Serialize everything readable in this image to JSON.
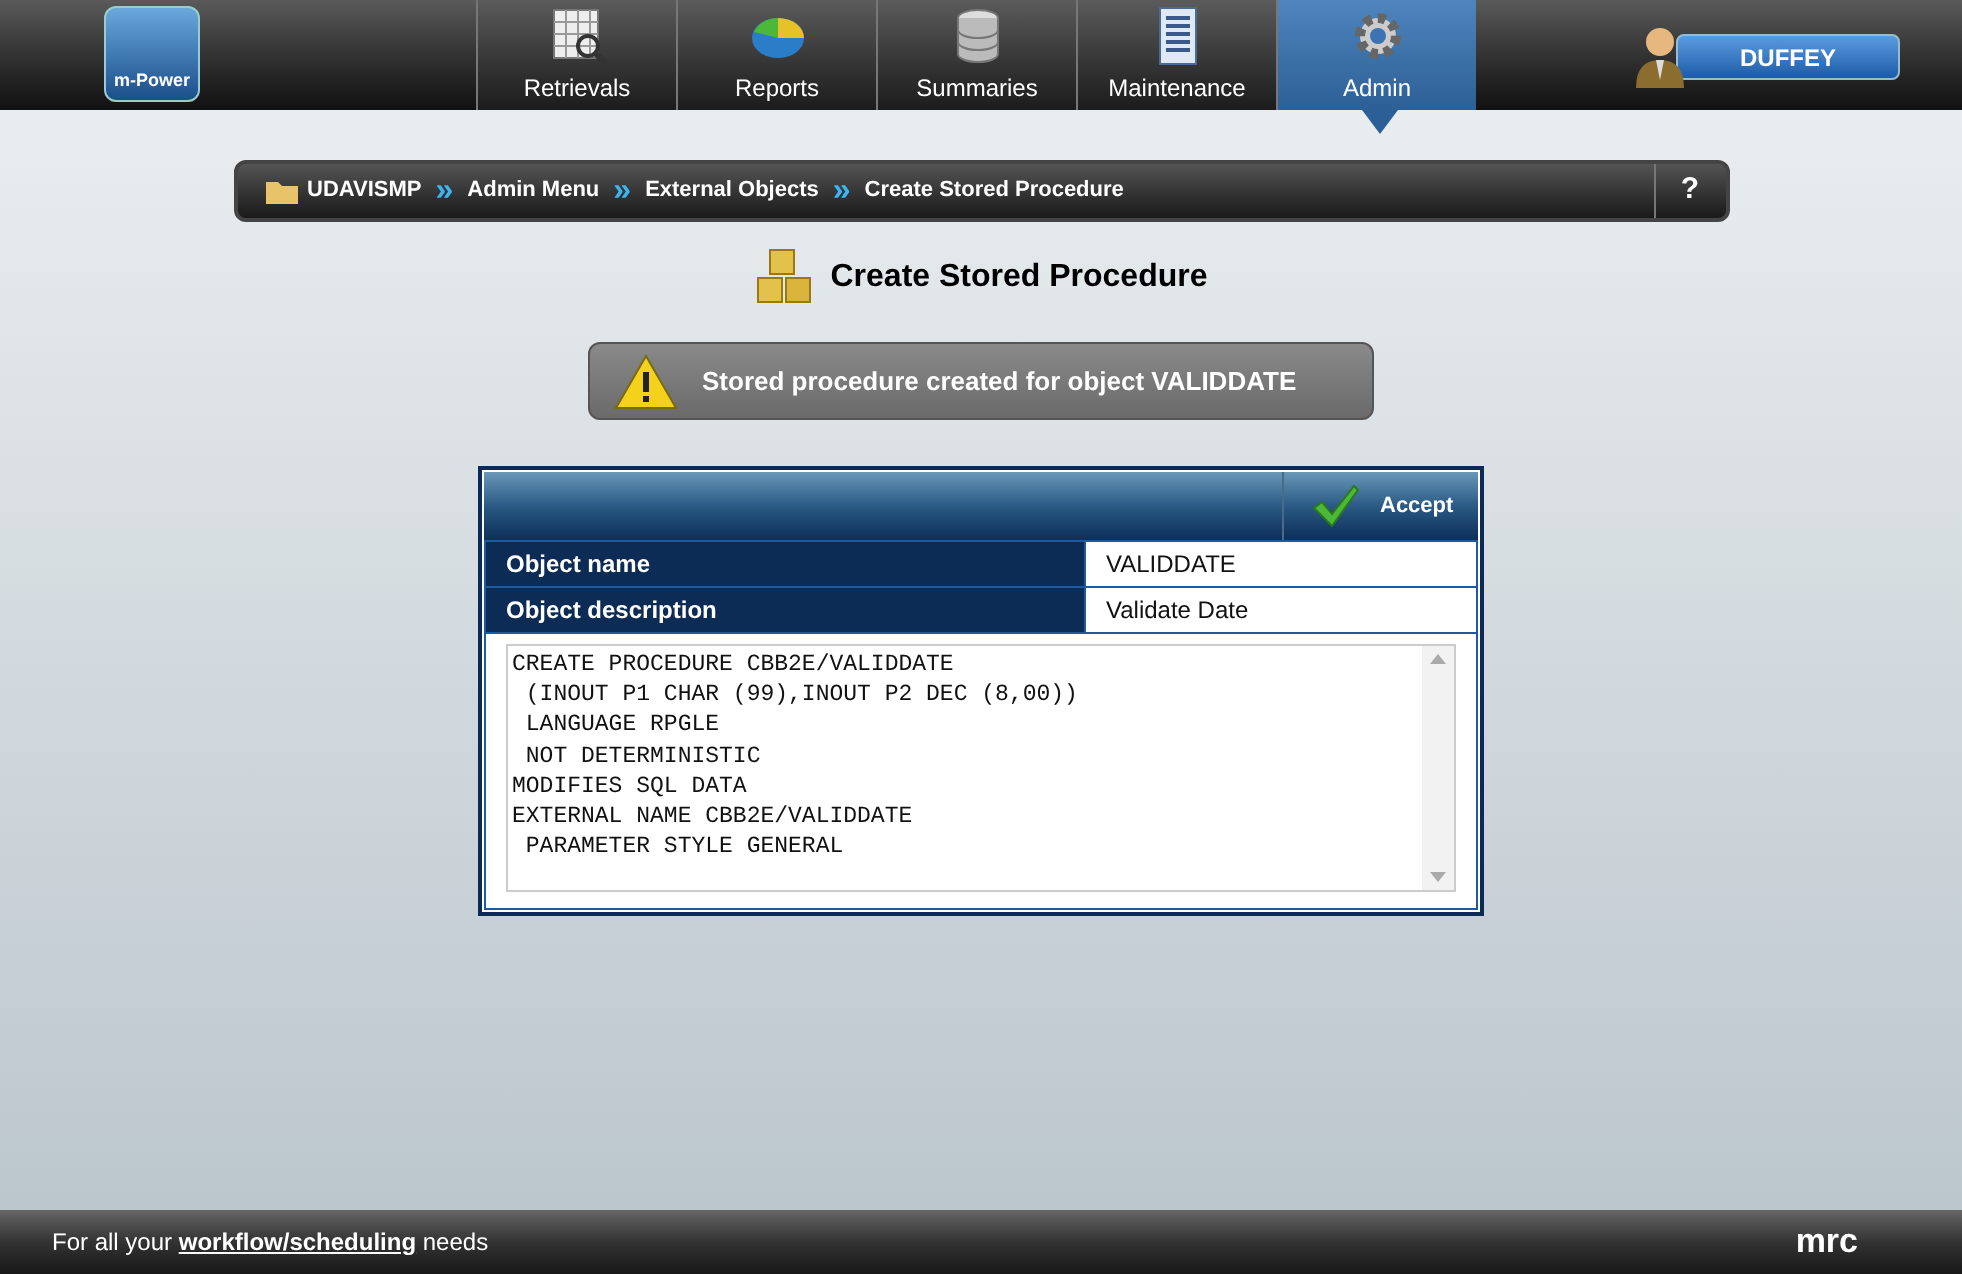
{
  "logo": {
    "label": "m-Power"
  },
  "nav_tabs": [
    {
      "label": "Retrievals",
      "kind": "grid",
      "selected": false
    },
    {
      "label": "Reports",
      "kind": "pie",
      "selected": false
    },
    {
      "label": "Summaries",
      "kind": "database",
      "selected": false
    },
    {
      "label": "Maintenance",
      "kind": "form",
      "selected": false
    },
    {
      "label": "Admin",
      "kind": "gear",
      "selected": true
    }
  ],
  "user_button": {
    "label": "DUFFEY"
  },
  "breadcrumb": {
    "items": [
      "UDAVISMP",
      "Admin Menu",
      "External Objects",
      "Create Stored Procedure"
    ],
    "separator": "»",
    "help": "?"
  },
  "page_title": "Create Stored Procedure",
  "alert": {
    "message": "Stored procedure created for object VALIDDATE"
  },
  "panel": {
    "accept_button": "Accept",
    "fields": [
      {
        "label": "Object name",
        "value": "VALIDDATE"
      },
      {
        "label": "Object description",
        "value": "Validate Date"
      }
    ],
    "code_lines": [
      "CREATE PROCEDURE CBB2E/VALIDDATE",
      " (INOUT P1 CHAR (99),INOUT P2 DEC (8,00))",
      " LANGUAGE RPGLE",
      " NOT DETERMINISTIC",
      "MODIFIES SQL DATA",
      "EXTERNAL NAME CBB2E/VALIDDATE",
      " PARAMETER STYLE GENERAL"
    ]
  },
  "footer": {
    "text_before": "For all your",
    "link": "workflow/scheduling",
    "text_after": "needs",
    "brand": "mrc"
  }
}
